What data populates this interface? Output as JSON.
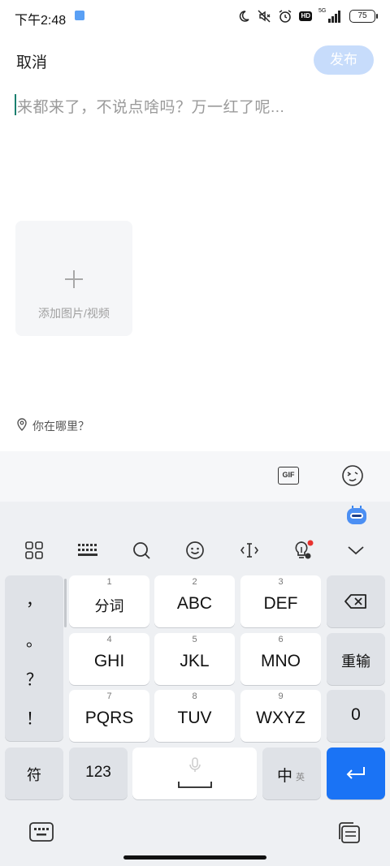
{
  "status_bar": {
    "time": "下午2:48",
    "network": "5G",
    "battery": "75",
    "hd_badge": "HD"
  },
  "header": {
    "cancel_label": "取消",
    "publish_label": "发布"
  },
  "composer": {
    "placeholder": "来都来了，不说点啥吗？万一红了呢..."
  },
  "media": {
    "add_label": "添加图片/视频"
  },
  "location": {
    "label": "你在哪里？"
  },
  "toolbar": {
    "gif_label": "GIF"
  },
  "keyboard": {
    "punctuation": [
      "，",
      "。",
      "？",
      "！"
    ],
    "row1": [
      {
        "num": "1",
        "label": "分词"
      },
      {
        "num": "2",
        "label": "ABC"
      },
      {
        "num": "3",
        "label": "DEF"
      }
    ],
    "row2": [
      {
        "num": "4",
        "label": "GHI"
      },
      {
        "num": "5",
        "label": "JKL"
      },
      {
        "num": "6",
        "label": "MNO"
      }
    ],
    "row3": [
      {
        "num": "7",
        "label": "PQRS"
      },
      {
        "num": "8",
        "label": "TUV"
      },
      {
        "num": "9",
        "label": "WXYZ"
      }
    ],
    "retype_label": "重输",
    "zero_label": "0",
    "symbols_label": "符",
    "numbers_label": "123",
    "lang_main_label": "中",
    "lang_sub_label": "英"
  },
  "colors": {
    "publish_disabled": "#c7dcfb",
    "enter_key": "#1a73f5",
    "caret": "#1a7f6f"
  }
}
